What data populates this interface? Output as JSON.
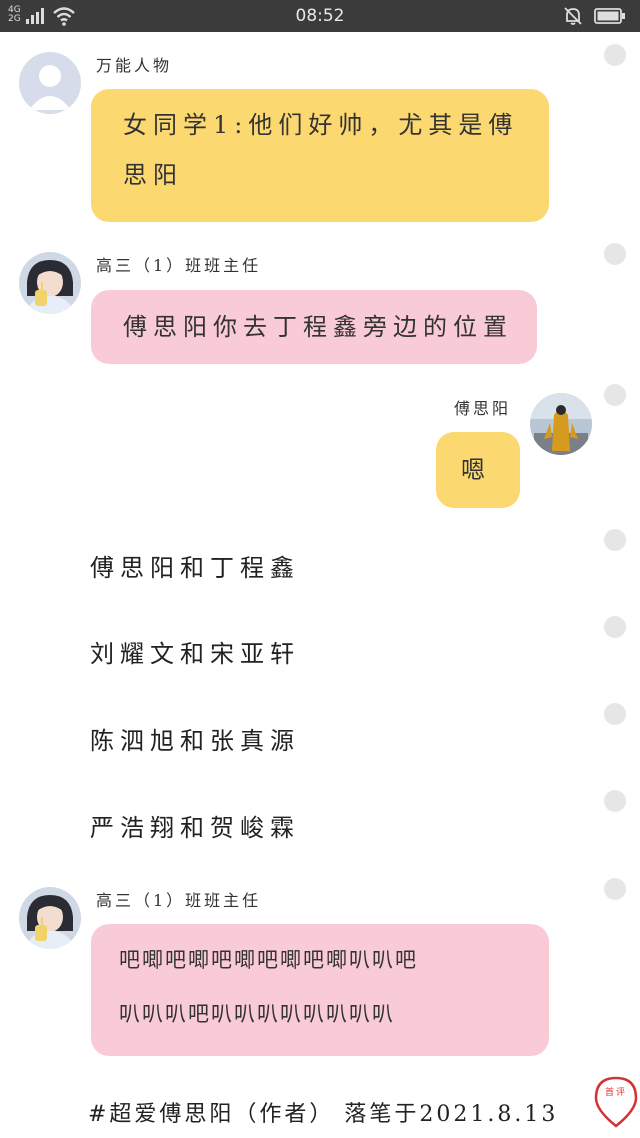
{
  "status_bar": {
    "time": "08:52",
    "network_labels": [
      "4G",
      "2G"
    ]
  },
  "messages": [
    {
      "sender": "万能人物",
      "text_lines": [
        "女同学1:他们好帅，尤其是傅",
        "思阳"
      ],
      "bubble_color": "#fbd870"
    },
    {
      "sender": "高三（1）班班主任",
      "text_lines": [
        "傅思阳你去丁程鑫旁边的位置"
      ],
      "bubble_color": "#f9cbd6"
    },
    {
      "sender": "傅思阳",
      "text_lines": [
        "嗯"
      ],
      "bubble_color": "#fbd870"
    }
  ],
  "narration": [
    "傅思阳和丁程鑫",
    "刘耀文和宋亚轩",
    "陈泗旭和张真源",
    "严浩翔和贺峻霖"
  ],
  "final_message": {
    "sender": "高三（1）班班主任",
    "text_lines": [
      "吧唧吧唧吧唧吧唧吧唧叭叭吧",
      "叭叭叭吧叭叭叭叭叭叭叭叭"
    ],
    "bubble_color": "#f9cbd6"
  },
  "footer": {
    "text": "#超爱傅思阳（作者） 落笔于2021.8.13"
  },
  "fab": {
    "label": "首评",
    "color": "#d33333"
  }
}
